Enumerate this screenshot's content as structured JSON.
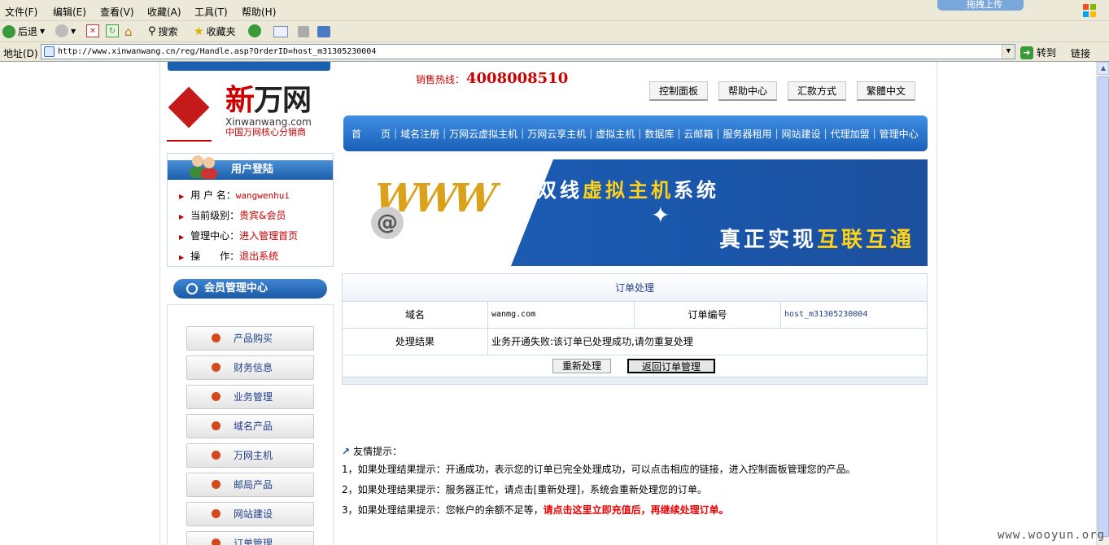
{
  "browser": {
    "menu": [
      "文件(F)",
      "编辑(E)",
      "查看(V)",
      "收藏(A)",
      "工具(T)",
      "帮助(H)"
    ],
    "upload_tab": "拖拽上传",
    "toolbar": {
      "back": "后退",
      "search": "搜索",
      "favorites": "收藏夹"
    },
    "address_label": "地址(D)",
    "url": "http://www.xinwanwang.cn/reg/Handle.asp?OrderID=host_m31305230004",
    "go": "转到",
    "links": "链接"
  },
  "header": {
    "logo_big_red": "新",
    "logo_big": "万网",
    "logo_domain": "Xinwanwang.com",
    "logo_sub": "中国万网核心分销商",
    "hotline_label": "销售热线：",
    "hotline_number": "4008008510",
    "top_buttons": [
      "控制面板",
      "帮助中心",
      "汇款方式",
      "繁體中文"
    ],
    "nav": [
      "首　　页",
      "域名注册",
      "万网云虚拟主机",
      "万网云享主机",
      "虚拟主机",
      "数据库",
      "云邮箱",
      "服务器租用",
      "网站建设",
      "代理加盟",
      "管理中心"
    ]
  },
  "login": {
    "title": "用户登陆",
    "rows": [
      {
        "label": "用 户 名：",
        "value": "wangwenhui"
      },
      {
        "label": "当前级别：",
        "value": "贵宾&会员"
      },
      {
        "label": "管理中心：",
        "value": "进入管理首页"
      },
      {
        "label": "操　　作：",
        "value": "退出系统"
      }
    ]
  },
  "member": {
    "title": "会员管理中心",
    "items": [
      "产品购买",
      "财务信息",
      "业务管理",
      "域名产品",
      "万网主机",
      "邮局产品",
      "网站建设",
      "订单管理"
    ]
  },
  "banner": {
    "line1_a": "双线",
    "line1_b": "虚拟主机",
    "line1_c": "系统",
    "line2_a": "真正实现",
    "line2_b": "互联互通"
  },
  "order": {
    "title": "订单处理",
    "domain_label": "域名",
    "domain_value": "wanmg.com",
    "order_no_label": "订单编号",
    "order_no_value": "host_m31305230004",
    "result_label": "处理结果",
    "result_value": "业务开通失败:该订单已处理成功,请勿重复处理",
    "reprocess_button": "重新处理",
    "back_button": "返回订单管理"
  },
  "tips": {
    "title": "友情提示：",
    "line1": "1，如果处理结果提示：开通成功，表示您的订单已完全处理成功，可以点击相应的链接，进入控制面板管理您的产品。",
    "line2": "2，如果处理结果提示：服务器正忙，请点击[重新处理]，系统会重新处理您的订单。",
    "line3_a": "3，如果处理结果提示：您帐户的余额不足等，",
    "line3_b": "请点击这里立即充值后，再继续处理订单。"
  },
  "watermark": "www.wooyun.org",
  "colors": {
    "accent": "#1a5fb8",
    "hotline": "#cc0000",
    "link": "#1f3f8c"
  }
}
